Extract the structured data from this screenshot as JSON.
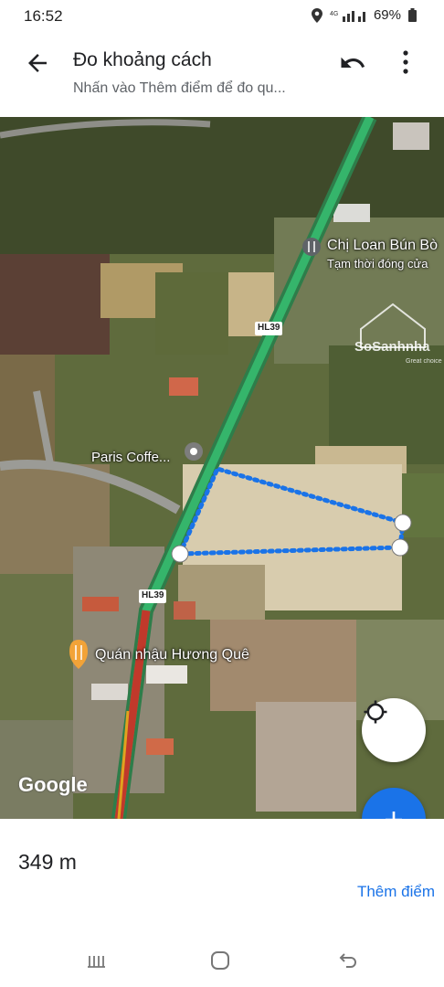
{
  "status_bar": {
    "time": "16:52",
    "battery": "69%"
  },
  "header": {
    "title": "Đo khoảng cách",
    "subtitle": "Nhấn vào Thêm điểm để đo qu..."
  },
  "map": {
    "road_labels": [
      "HL39",
      "HL39"
    ],
    "places": [
      {
        "name": "Chị Loan Bún Bò",
        "status": "Tạm thời đóng cửa"
      },
      {
        "name": "Paris Coffe..."
      },
      {
        "name": "Quán nhậu Hương Quê"
      }
    ],
    "watermark": "SoSanhnha",
    "watermark_sub": "Great choice",
    "attribution": "Google",
    "measure_color": "#1a73e8"
  },
  "measurement": {
    "distance": "349 m",
    "add_point_label": "Thêm điểm"
  },
  "icons": {
    "back": "arrow-back-icon",
    "undo": "undo-icon",
    "more": "more-vert-icon",
    "locate": "my-location-icon",
    "add": "plus-icon"
  }
}
